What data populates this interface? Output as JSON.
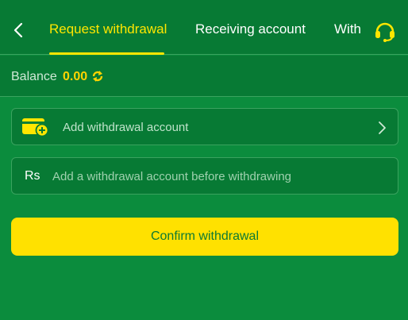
{
  "header": {
    "back_icon": "chevron-left-icon",
    "tabs": [
      {
        "label": "Request withdrawal",
        "active": true
      },
      {
        "label": "Receiving account",
        "active": false
      },
      {
        "label": "With",
        "active": false
      }
    ],
    "support_icon": "headset-icon"
  },
  "balance": {
    "label": "Balance",
    "value": "0.00",
    "refresh_icon": "refresh-icon"
  },
  "add_account": {
    "icon": "wallet-add-icon",
    "label": "Add withdrawal account",
    "chevron_icon": "chevron-right-icon"
  },
  "amount": {
    "currency": "Rs",
    "placeholder": "Add a withdrawal account before withdrawing",
    "value": ""
  },
  "confirm_button": {
    "label": "Confirm withdrawal"
  },
  "colors": {
    "background": "#0b8c3d",
    "panel": "#077a34",
    "accent": "#ffe600",
    "balance_value": "#ffd400"
  }
}
